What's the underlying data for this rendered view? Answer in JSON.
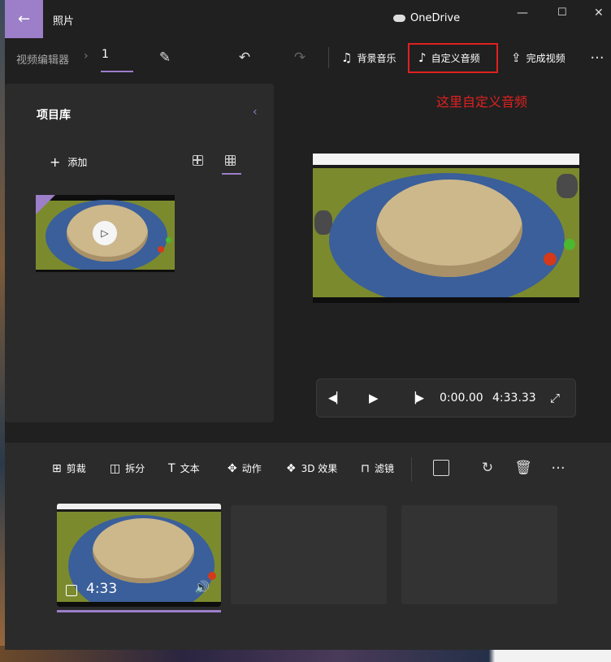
{
  "titlebar": {
    "back_icon": "arrow-left-icon",
    "app_title": "照片",
    "cloud_label": "OneDrive",
    "minimize_icon": "minimize-icon",
    "maximize_icon": "maximize-icon",
    "close_icon": "close-icon"
  },
  "toolbar": {
    "breadcrumb_parent": "视频编辑器",
    "project_name": "1",
    "bg_music_label": "背景音乐",
    "custom_audio_label": "自定义音频",
    "finish_video_label": "完成视频",
    "more_icon": "more-icon"
  },
  "annotation": {
    "text": "这里自定义音频",
    "color": "#e02020"
  },
  "library": {
    "title": "项目库",
    "add_label": "添加"
  },
  "player": {
    "current_time": "0:00.00",
    "total_time": "4:33.33"
  },
  "storyboard": {
    "tools": {
      "trim": "剪裁",
      "split": "拆分",
      "text": "文本",
      "motion": "动作",
      "effects3d": "3D 效果",
      "filters": "滤镜"
    },
    "clip_duration": "4:33"
  },
  "colors": {
    "accent": "#9c7ec9",
    "highlight": "#e02020",
    "window_bg": "#202020",
    "panel_bg": "#2b2b2b"
  }
}
